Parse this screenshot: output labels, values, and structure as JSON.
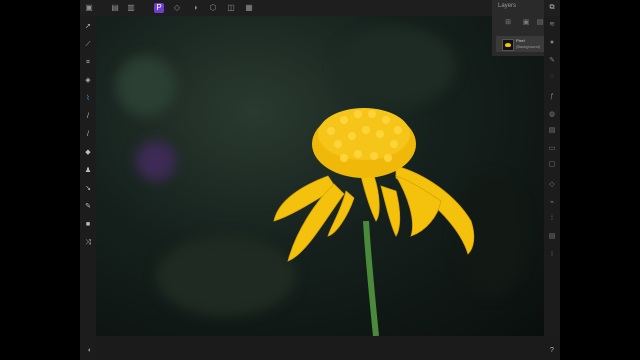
{
  "layers_panel": {
    "title": "Layers",
    "layer": {
      "name": "Pixel",
      "subtitle": "(Background)"
    }
  },
  "statusbar": {
    "help": "?",
    "undo": "◐"
  },
  "top_toolbar": {
    "personas": [
      "photo-persona-icon",
      "liquify-persona-icon",
      "develop-persona-icon",
      "tonemap-persona-icon",
      "export-persona-icon"
    ],
    "active_persona": "photo-persona-icon"
  },
  "colors": {
    "accent": "#6a3fd1",
    "selected_tool": "#3aa0ff",
    "flower": "#f4c20d",
    "stem": "#4a8a3a"
  }
}
